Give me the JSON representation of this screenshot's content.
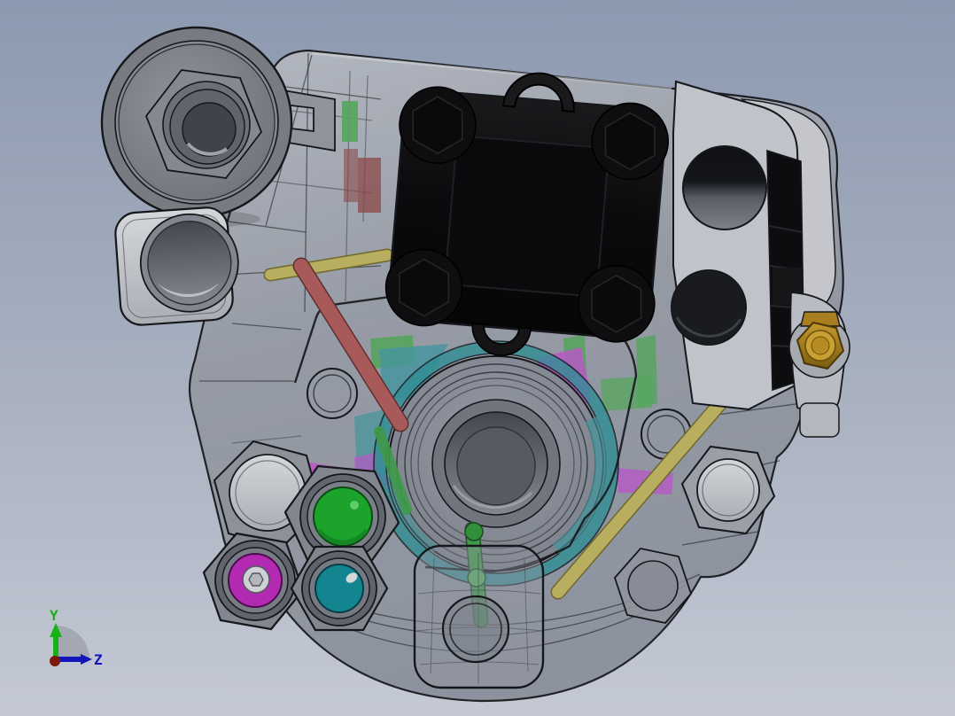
{
  "title": "3D CAD assembly viewport",
  "view": {
    "kind": "shaded-with-edges",
    "projection": "front"
  },
  "colors": {
    "bg-top": "#8c99b0",
    "bg-mid": "#a9b1c0",
    "bg-bottom": "#c4c9d4",
    "edge": "#16171b",
    "housing": "#9aa0ac",
    "housing-light": "#c6c8cd",
    "housing-dark": "#6f737c",
    "silver": "#cdd0d5",
    "black-block": "#0b0b0d",
    "black-face": "#131316",
    "plate": "#c0c3c9",
    "hole-dark": "#191b1f",
    "strip-black": "#0d0d10",
    "brass": "#c49a2e",
    "brass-dark": "#7a5c10",
    "teal-ring": "#2e8d93",
    "plug-green": "#1ca32c",
    "plug-magenta": "#b32ab2",
    "plug-teal": "#128590",
    "rod-red": "#a85a5a",
    "rod-red-dark": "#5f2f2f",
    "dark-red": "#8a4343",
    "rod-yellow": "#b7ae60",
    "rod-yellow-dark": "#6e682f",
    "rod-green": "#3f9a49",
    "rod-green-dark": "#23522a",
    "patch-green": "#55a55c",
    "patch-magenta": "#b659c4",
    "patch-teal": "#43959d",
    "triad-y": "#16b216",
    "triad-z": "#1414bb",
    "triad-origin": "#7d180c",
    "triad-fan": "#a0a5ae"
  },
  "triad": {
    "y_label": "Y",
    "z_label": "Z"
  },
  "model": {
    "description": "Gas valve / regulator assembly with semi-transparent gray housing",
    "parts": [
      {
        "id": "housing",
        "label": "transparent valve body housing",
        "color_key": "housing"
      },
      {
        "id": "solenoid-block",
        "label": "black solenoid block with four hex sockets",
        "color_key": "black-block"
      },
      {
        "id": "inlet-boss",
        "label": "top-left circular inlet boss with hex nut"
      },
      {
        "id": "side-flange",
        "label": "left square port flange with bore"
      },
      {
        "id": "mounting-plate",
        "label": "right mounting plate with two holes",
        "color_key": "plate"
      },
      {
        "id": "brass-fitting",
        "label": "brass hex fitting",
        "color_key": "brass"
      },
      {
        "id": "diaphragm",
        "label": "central diaphragm with teal seal ring",
        "color_key": "teal-ring"
      },
      {
        "id": "plug-green",
        "label": "green port plug",
        "color_key": "plug-green"
      },
      {
        "id": "plug-magenta",
        "label": "magenta port plug",
        "color_key": "plug-magenta"
      },
      {
        "id": "plug-teal",
        "label": "teal port plug",
        "color_key": "plug-teal"
      },
      {
        "id": "plug-silver",
        "label": "plain silver hex boss",
        "color_key": "silver"
      },
      {
        "id": "rod-red",
        "label": "red internal rod",
        "color_key": "rod-red"
      },
      {
        "id": "rod-yellow",
        "label": "yellow internal rods",
        "color_key": "rod-yellow"
      },
      {
        "id": "rod-green",
        "label": "green internal rod",
        "color_key": "rod-green"
      },
      {
        "id": "dome",
        "label": "bottom diaphragm dome cover"
      }
    ]
  }
}
